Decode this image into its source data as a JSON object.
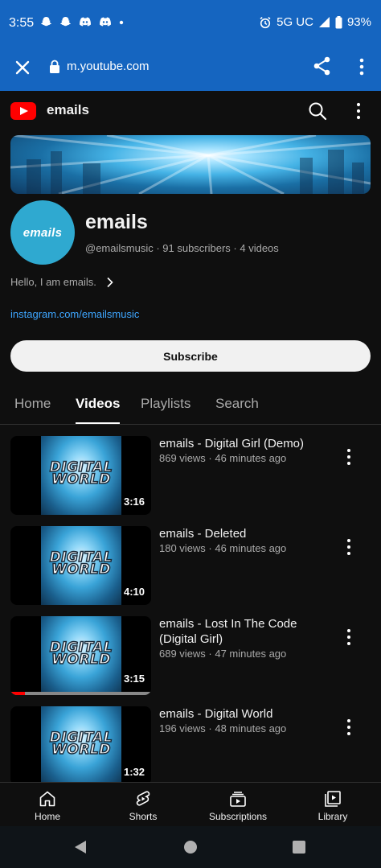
{
  "status_bar": {
    "time": "3:55",
    "network": "5G UC",
    "battery": "93%"
  },
  "browser": {
    "url": "m.youtube.com"
  },
  "header": {
    "title": "emails"
  },
  "channel": {
    "avatar_text": "emails",
    "name": "emails",
    "meta": "@emailsmusic · 91 subscribers · 4 videos",
    "about": "Hello, I am emails.",
    "link": "instagram.com/emailsmusic",
    "subscribe_label": "Subscribe"
  },
  "tabs": [
    {
      "label": "Home"
    },
    {
      "label": "Videos",
      "active": true
    },
    {
      "label": "Playlists"
    },
    {
      "label": "Search"
    }
  ],
  "videos": [
    {
      "thumb_text": "DIGITAL WORLD",
      "duration": "3:16",
      "title": "emails - Digital Girl (Demo)",
      "meta": "869 views · 46 minutes ago"
    },
    {
      "thumb_text": "DIGITAL WORLD",
      "duration": "4:10",
      "title": "emails - Deleted",
      "meta": "180 views · 46 minutes ago"
    },
    {
      "thumb_text": "DIGITAL WORLD",
      "duration": "3:15",
      "title": "emails - Lost In The Code (Digital Girl)",
      "meta": "689 views · 47 minutes ago",
      "watched_fraction": 0.1
    },
    {
      "thumb_text": "DIGITAL WORLD",
      "duration": "1:32",
      "title": "emails - Digital World",
      "meta": "196 views · 48 minutes ago"
    }
  ],
  "bottom_nav": [
    {
      "label": "Home",
      "icon": "home-icon"
    },
    {
      "label": "Shorts",
      "icon": "shorts-icon"
    },
    {
      "label": "Subscriptions",
      "icon": "subscriptions-icon"
    },
    {
      "label": "Library",
      "icon": "library-icon"
    }
  ],
  "colors": {
    "browser_bar": "#1565c0",
    "youtube_red": "#ff0000",
    "link": "#3ea6ff",
    "background": "#0f0f0f"
  }
}
